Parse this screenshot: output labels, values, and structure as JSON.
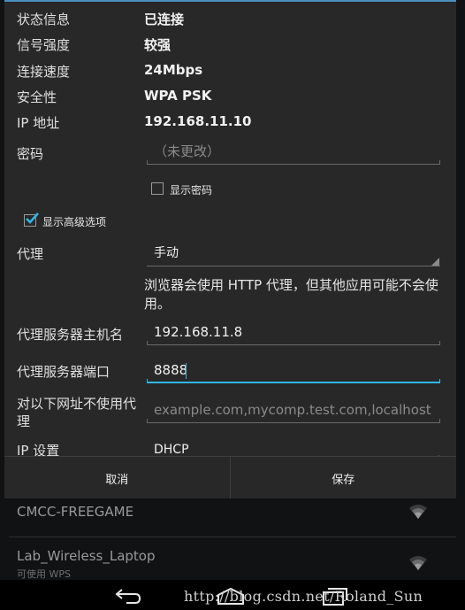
{
  "background_networks": [
    {
      "name": "CMCC-FREEGAME",
      "sub": ""
    },
    {
      "name": "Lab_Wireless_Laptop",
      "sub": "可使用 WPS"
    }
  ],
  "dialog": {
    "info": [
      {
        "label": "状态信息",
        "value": "已连接"
      },
      {
        "label": "信号强度",
        "value": "较强"
      },
      {
        "label": "连接速度",
        "value": "24Mbps"
      },
      {
        "label": "安全性",
        "value": "WPA PSK"
      },
      {
        "label": "IP 地址",
        "value": "192.168.11.10"
      }
    ],
    "password": {
      "label": "密码",
      "placeholder": "（未更改）",
      "value": ""
    },
    "show_password": {
      "label": "显示密码",
      "checked": false
    },
    "show_advanced": {
      "label": "显示高级选项",
      "checked": true
    },
    "proxy": {
      "label": "代理",
      "value": "手动"
    },
    "proxy_hint": "浏览器会使用 HTTP 代理，但其他应用可能不会使用。",
    "proxy_host": {
      "label": "代理服务器主机名",
      "value": "192.168.11.8"
    },
    "proxy_port": {
      "label": "代理服务器端口",
      "value": "8888"
    },
    "bypass": {
      "label": "对以下网址不使用代理",
      "placeholder": "example.com,mycomp.test.com,localhost",
      "value": ""
    },
    "ip_settings": {
      "label": "IP 设置",
      "value": "DHCP"
    },
    "buttons": {
      "cancel": "取消",
      "save": "保存"
    }
  },
  "watermark": "http://blog.csdn.net/Roland_Sun",
  "colors": {
    "accent": "#33b5e5",
    "dialog_bg": "#282828"
  },
  "icons": [
    "wifi-icon",
    "back-icon",
    "home-icon",
    "recents-icon"
  ]
}
